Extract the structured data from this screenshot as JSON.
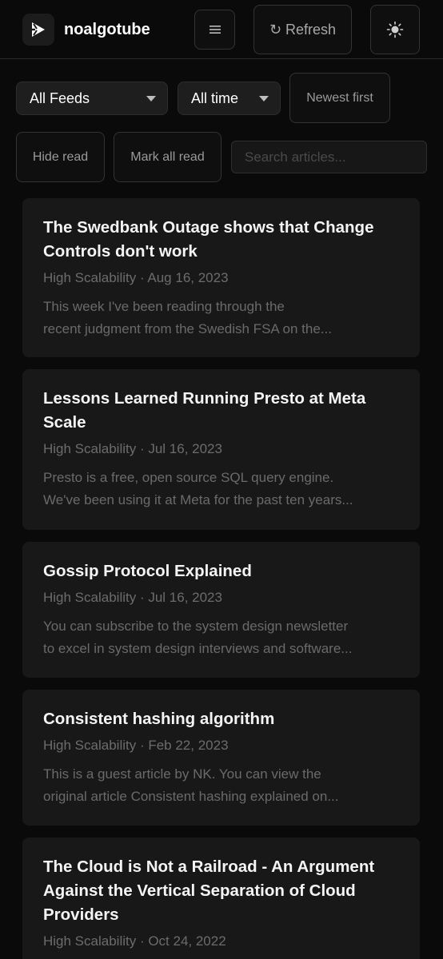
{
  "app": {
    "name": "noalgotube",
    "menu_icon": "hamburger-icon",
    "refresh_label": "↻ Refresh",
    "theme_icon": "sun-icon"
  },
  "filters": {
    "feeds_selected": "All Feeds",
    "time_selected": "All time",
    "sort_label": "Newest first",
    "hide_read_label": "Hide read",
    "mark_all_read_label": "Mark all read",
    "search_placeholder": "Search articles..."
  },
  "colors": {
    "background": "#0a0a0a",
    "card": "#181818",
    "title": "#f4f4f4",
    "meta": "#6c6c6c"
  },
  "articles": [
    {
      "title": "The Swedbank Outage shows that Change Controls don't work",
      "meta": "High Scalability · Aug 16, 2023",
      "excerpt_line1": "This week I've been reading through the",
      "excerpt_line2": "recent judgment from the Swedish FSA on the..."
    },
    {
      "title": "Lessons Learned Running Presto at Meta Scale",
      "meta": "High Scalability · Jul 16, 2023",
      "excerpt_line1": "Presto is a free, open source SQL query engine.",
      "excerpt_line2": "We've been using it at Meta for the past ten years..."
    },
    {
      "title": "Gossip Protocol Explained",
      "meta": "High Scalability · Jul 16, 2023",
      "excerpt_line1": "You can subscribe to the system design newsletter",
      "excerpt_line2": "to excel in system design interviews and software..."
    },
    {
      "title": "Consistent hashing algorithm",
      "meta": "High Scalability · Feb 22, 2023",
      "excerpt_line1": "This is a guest article by NK. You can view the",
      "excerpt_line2": "original article Consistent hashing explained on..."
    },
    {
      "title": "The Cloud is Not a Railroad - An Argument Against the Vertical Separation of Cloud Providers",
      "meta": "High Scalability · Oct 24, 2022"
    }
  ]
}
